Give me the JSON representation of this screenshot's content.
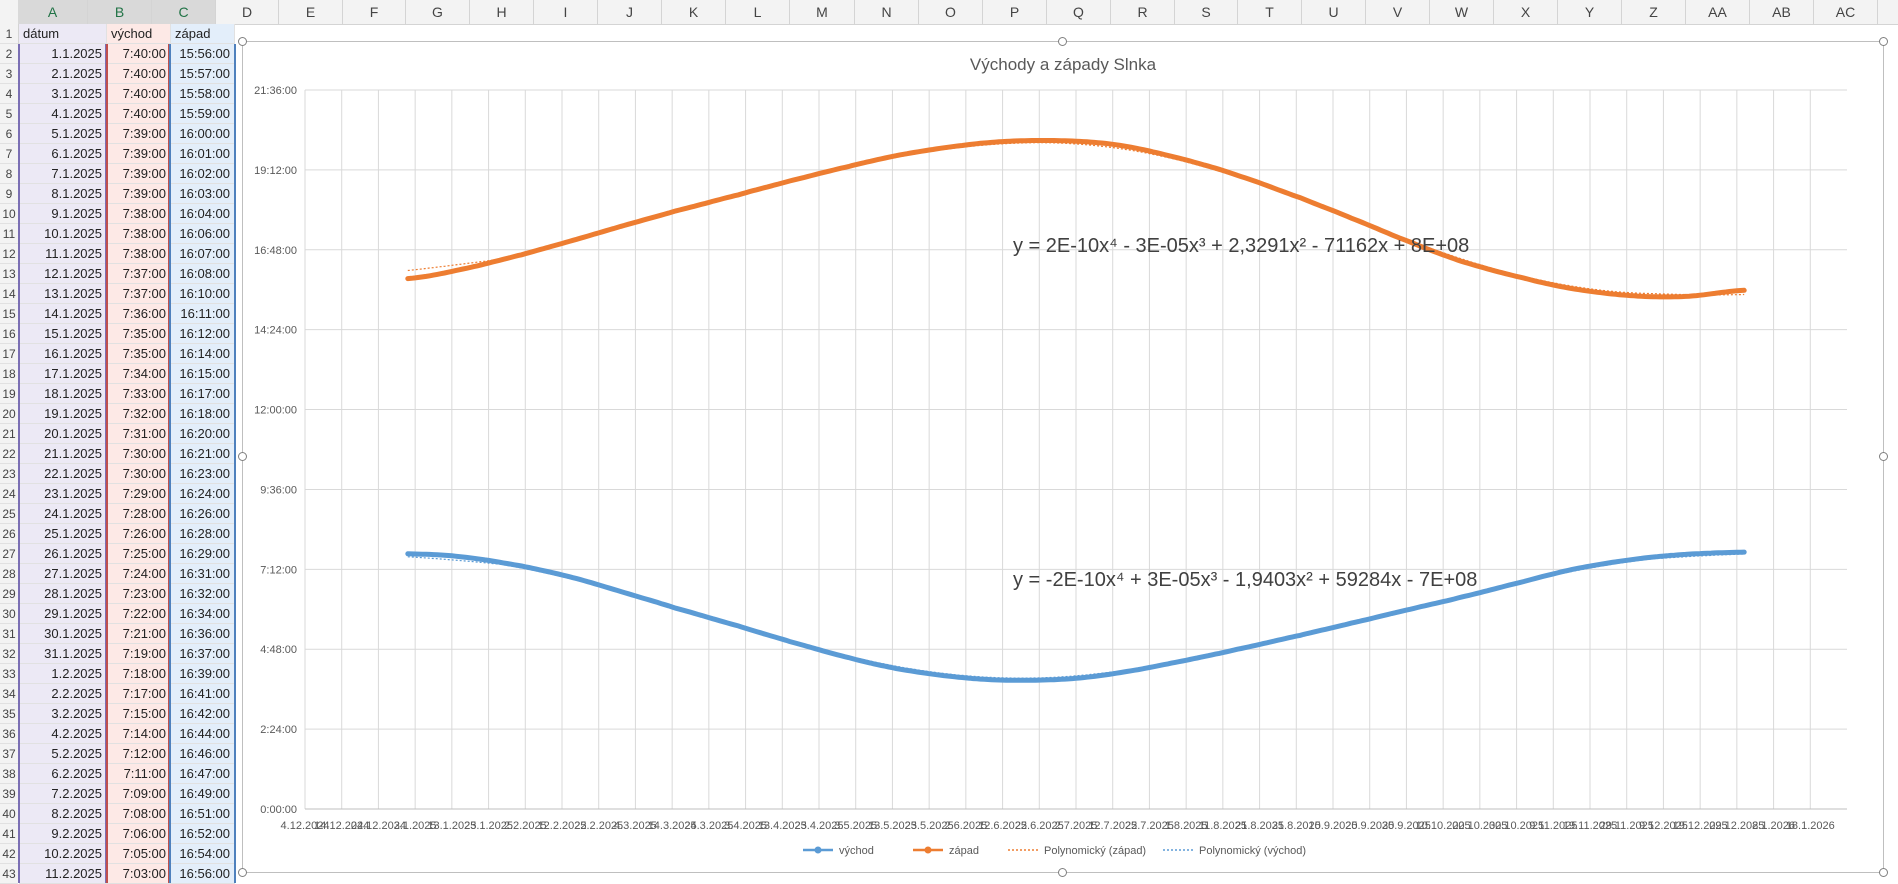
{
  "columns": [
    "A",
    "B",
    "C",
    "D",
    "E",
    "F",
    "G",
    "H",
    "I",
    "J",
    "K",
    "L",
    "M",
    "N",
    "O",
    "P",
    "Q",
    "R",
    "S",
    "T",
    "U",
    "V",
    "W",
    "X",
    "Y",
    "Z",
    "AA",
    "AB",
    "AC"
  ],
  "headers": {
    "a": "dátum",
    "b": "východ",
    "c": "západ"
  },
  "rows": [
    [
      "1.1.2025",
      "7:40:00",
      "15:56:00"
    ],
    [
      "2.1.2025",
      "7:40:00",
      "15:57:00"
    ],
    [
      "3.1.2025",
      "7:40:00",
      "15:58:00"
    ],
    [
      "4.1.2025",
      "7:40:00",
      "15:59:00"
    ],
    [
      "5.1.2025",
      "7:39:00",
      "16:00:00"
    ],
    [
      "6.1.2025",
      "7:39:00",
      "16:01:00"
    ],
    [
      "7.1.2025",
      "7:39:00",
      "16:02:00"
    ],
    [
      "8.1.2025",
      "7:39:00",
      "16:03:00"
    ],
    [
      "9.1.2025",
      "7:38:00",
      "16:04:00"
    ],
    [
      "10.1.2025",
      "7:38:00",
      "16:06:00"
    ],
    [
      "11.1.2025",
      "7:38:00",
      "16:07:00"
    ],
    [
      "12.1.2025",
      "7:37:00",
      "16:08:00"
    ],
    [
      "13.1.2025",
      "7:37:00",
      "16:10:00"
    ],
    [
      "14.1.2025",
      "7:36:00",
      "16:11:00"
    ],
    [
      "15.1.2025",
      "7:35:00",
      "16:12:00"
    ],
    [
      "16.1.2025",
      "7:35:00",
      "16:14:00"
    ],
    [
      "17.1.2025",
      "7:34:00",
      "16:15:00"
    ],
    [
      "18.1.2025",
      "7:33:00",
      "16:17:00"
    ],
    [
      "19.1.2025",
      "7:32:00",
      "16:18:00"
    ],
    [
      "20.1.2025",
      "7:31:00",
      "16:20:00"
    ],
    [
      "21.1.2025",
      "7:30:00",
      "16:21:00"
    ],
    [
      "22.1.2025",
      "7:30:00",
      "16:23:00"
    ],
    [
      "23.1.2025",
      "7:29:00",
      "16:24:00"
    ],
    [
      "24.1.2025",
      "7:28:00",
      "16:26:00"
    ],
    [
      "25.1.2025",
      "7:26:00",
      "16:28:00"
    ],
    [
      "26.1.2025",
      "7:25:00",
      "16:29:00"
    ],
    [
      "27.1.2025",
      "7:24:00",
      "16:31:00"
    ],
    [
      "28.1.2025",
      "7:23:00",
      "16:32:00"
    ],
    [
      "29.1.2025",
      "7:22:00",
      "16:34:00"
    ],
    [
      "30.1.2025",
      "7:21:00",
      "16:36:00"
    ],
    [
      "31.1.2025",
      "7:19:00",
      "16:37:00"
    ],
    [
      "1.2.2025",
      "7:18:00",
      "16:39:00"
    ],
    [
      "2.2.2025",
      "7:17:00",
      "16:41:00"
    ],
    [
      "3.2.2025",
      "7:15:00",
      "16:42:00"
    ],
    [
      "4.2.2025",
      "7:14:00",
      "16:44:00"
    ],
    [
      "5.2.2025",
      "7:12:00",
      "16:46:00"
    ],
    [
      "6.2.2025",
      "7:11:00",
      "16:47:00"
    ],
    [
      "7.2.2025",
      "7:09:00",
      "16:49:00"
    ],
    [
      "8.2.2025",
      "7:08:00",
      "16:51:00"
    ],
    [
      "9.2.2025",
      "7:06:00",
      "16:52:00"
    ],
    [
      "10.2.2025",
      "7:05:00",
      "16:54:00"
    ],
    [
      "11.2.2025",
      "7:03:00",
      "16:56:00"
    ]
  ],
  "chart_data": {
    "type": "line",
    "title": "Východy a západy Slnka",
    "ylabel": "",
    "xlabel": "",
    "y_ticks": [
      "0:00:00",
      "2:24:00",
      "4:48:00",
      "7:12:00",
      "9:36:00",
      "12:00:00",
      "14:24:00",
      "16:48:00",
      "19:12:00",
      "21:36:00"
    ],
    "ylim": [
      "0:00:00",
      "21:36:00"
    ],
    "x_ticks": [
      "4.12.2024",
      "14.12.2024",
      "24.12.2024",
      "3.1.2025",
      "13.1.2025",
      "23.1.2025",
      "2.2.2025",
      "12.2.2025",
      "22.2.2025",
      "4.3.2025",
      "14.3.2025",
      "24.3.2025",
      "3.4.2025",
      "13.4.2025",
      "23.4.2025",
      "3.5.2025",
      "13.5.2025",
      "23.5.2025",
      "2.6.2025",
      "12.6.2025",
      "22.6.2025",
      "2.7.2025",
      "12.7.2025",
      "22.7.2025",
      "1.8.2025",
      "11.8.2025",
      "21.8.2025",
      "31.8.2025",
      "10.9.2025",
      "20.9.2025",
      "30.9.2025",
      "10.10.2025",
      "20.10.2025",
      "30.10.2025",
      "9.11.2025",
      "19.11.2025",
      "29.11.2025",
      "9.12.2025",
      "19.12.2025",
      "29.12.2025",
      "8.1.2026",
      "18.1.2026"
    ],
    "xlim": [
      "4.12.2024",
      "28.1.2026"
    ],
    "grid": true,
    "legend_position": "bottom",
    "legend": [
      "východ",
      "západ",
      "Polynomický (západ)",
      "Polynomický (východ)"
    ],
    "equations": {
      "zapad": "y = 2E-10x⁴ - 3E-05x³ + 2,3291x² - 71162x + 8E+08",
      "vychod": "y = -2E-10x⁴ + 3E-05x³ - 1,9403x² + 59284x - 7E+08"
    },
    "series": [
      {
        "name": "východ",
        "color": "#5b9bd5",
        "x": [
          "1.1.2025",
          "15.1.2025",
          "1.2.2025",
          "15.2.2025",
          "1.3.2025",
          "15.3.2025",
          "1.4.2025",
          "15.4.2025",
          "1.5.2025",
          "15.5.2025",
          "1.6.2025",
          "15.6.2025",
          "1.7.2025",
          "15.7.2025",
          "1.8.2025",
          "15.8.2025",
          "1.9.2025",
          "15.9.2025",
          "1.10.2025",
          "15.10.2025",
          "1.11.2025",
          "15.11.2025",
          "1.12.2025",
          "15.12.2025",
          "31.12.2025"
        ],
        "y": [
          "7:40",
          "7:35",
          "7:18",
          "6:57",
          "6:30",
          "6:02",
          "5:30",
          "5:02",
          "4:33",
          "4:12",
          "3:57",
          "3:52",
          "3:55",
          "4:07",
          "4:28",
          "4:48",
          "5:13",
          "5:35",
          "6:00",
          "6:22",
          "6:50",
          "7:13",
          "7:30",
          "7:39",
          "7:43"
        ]
      },
      {
        "name": "západ",
        "color": "#ed7d31",
        "x": [
          "1.1.2025",
          "15.1.2025",
          "1.2.2025",
          "15.2.2025",
          "1.3.2025",
          "15.3.2025",
          "1.4.2025",
          "15.4.2025",
          "1.5.2025",
          "15.5.2025",
          "1.6.2025",
          "15.6.2025",
          "1.7.2025",
          "15.7.2025",
          "1.8.2025",
          "15.8.2025",
          "1.9.2025",
          "15.9.2025",
          "1.10.2025",
          "15.10.2025",
          "1.11.2025",
          "15.11.2025",
          "1.12.2025",
          "15.12.2025",
          "31.12.2025"
        ],
        "y": [
          "15:56",
          "16:12",
          "16:39",
          "17:05",
          "17:32",
          "17:58",
          "18:27",
          "18:52",
          "19:18",
          "19:39",
          "19:56",
          "20:04",
          "20:04",
          "19:55",
          "19:30",
          "19:02",
          "18:22",
          "17:45",
          "17:02",
          "16:27",
          "15:57",
          "15:37",
          "15:25",
          "15:24",
          "15:35"
        ]
      }
    ]
  }
}
